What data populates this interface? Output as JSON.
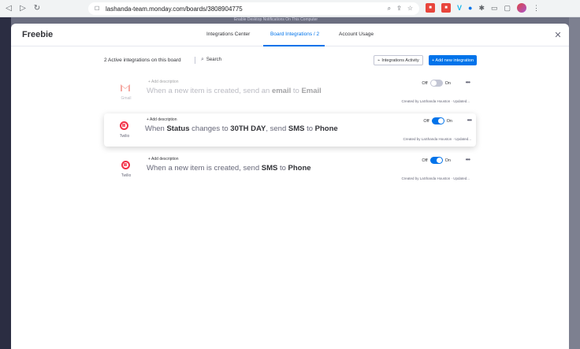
{
  "browser": {
    "url": "lashanda-team.monday.com/boards/3808904775",
    "banner": "Enable Desktop Notifications On This Computer"
  },
  "modal": {
    "title": "Freebie",
    "tabs": [
      {
        "label": "Integrations Center"
      },
      {
        "label": "Board Integrations / 2"
      },
      {
        "label": "Account Usage"
      }
    ]
  },
  "toolbar": {
    "active_count": "2 Active integrations on this board",
    "search_label": "Search",
    "activity_label": "Integrations Activity",
    "add_label": "+ Add new integration"
  },
  "integrations": [
    {
      "service": "Gmail",
      "add_description": "+ Add description",
      "recipe_pre": "When a new item is created, send an ",
      "recipe_b1": "email",
      "recipe_mid": " to ",
      "recipe_b2": "Email",
      "off_label": "Off",
      "on_label": "On",
      "enabled": false,
      "created": "Created by LaShanda Houston · Updated..."
    },
    {
      "service": "Twilio",
      "add_description": "+ Add description",
      "recipe_pre": "When ",
      "recipe_b1": "Status",
      "recipe_mid": " changes to ",
      "recipe_b2": "30TH DAY",
      "recipe_mid2": ", send ",
      "recipe_b3": "SMS",
      "recipe_mid3": " to ",
      "recipe_b4": "Phone",
      "off_label": "Off",
      "on_label": "On",
      "enabled": true,
      "created": "Created by LaShanda Houston · Updated..."
    },
    {
      "service": "Twilio",
      "add_description": "+ Add description",
      "recipe_pre": "When a new item is created, send ",
      "recipe_b1": "SMS",
      "recipe_mid": " to ",
      "recipe_b2": "Phone",
      "off_label": "Off",
      "on_label": "On",
      "enabled": true,
      "created": "Created by LaShanda Houston · Updated..."
    }
  ],
  "colors": {
    "accent": "#0073ea",
    "twilio": "#f22f46",
    "gmail": "#ea4335"
  },
  "icons": {
    "close": "close-icon",
    "search": "search-icon",
    "more": "more-icon"
  }
}
